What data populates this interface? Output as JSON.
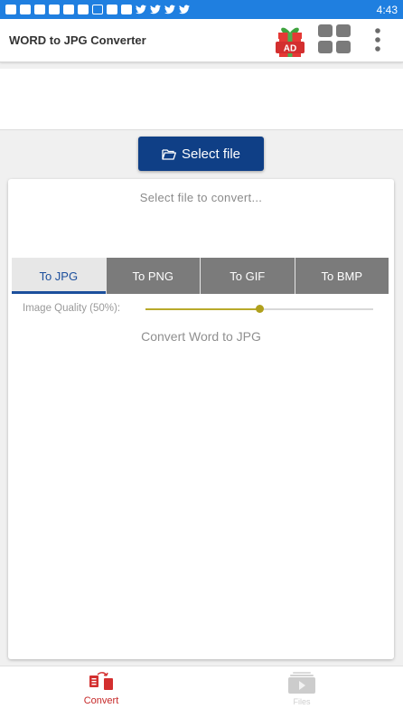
{
  "status_bar": {
    "time": "4:43",
    "icons": [
      "bluetooth-icon",
      "bluetooth-icon",
      "bluetooth-icon",
      "square-icon",
      "square-icon",
      "square-icon",
      "outline-square-icon",
      "facebook-icon",
      "file-icon",
      "twitter-icon",
      "twitter-icon",
      "twitter-icon",
      "twitter-icon"
    ]
  },
  "app_bar": {
    "title": "WORD to JPG Converter",
    "ad_badge": "AD"
  },
  "main": {
    "select_button_label": "Select file",
    "hint": "Select file to convert...",
    "tabs": [
      {
        "label": "To JPG",
        "active": true
      },
      {
        "label": "To PNG",
        "active": false
      },
      {
        "label": "To GIF",
        "active": false
      },
      {
        "label": "To BMP",
        "active": false
      }
    ],
    "quality_label": "Image Quality (50%):",
    "quality_value": 0.5,
    "convert_label": "Convert Word to JPG"
  },
  "bottom_nav": {
    "convert_label": "Convert",
    "files_label": "Files"
  },
  "colors": {
    "status_bar": "#1f7fe0",
    "primary": "#0f3f86",
    "active_tab_text": "#1c4f9c",
    "slider": "#b0a01c",
    "nav_active": "#c62828"
  }
}
